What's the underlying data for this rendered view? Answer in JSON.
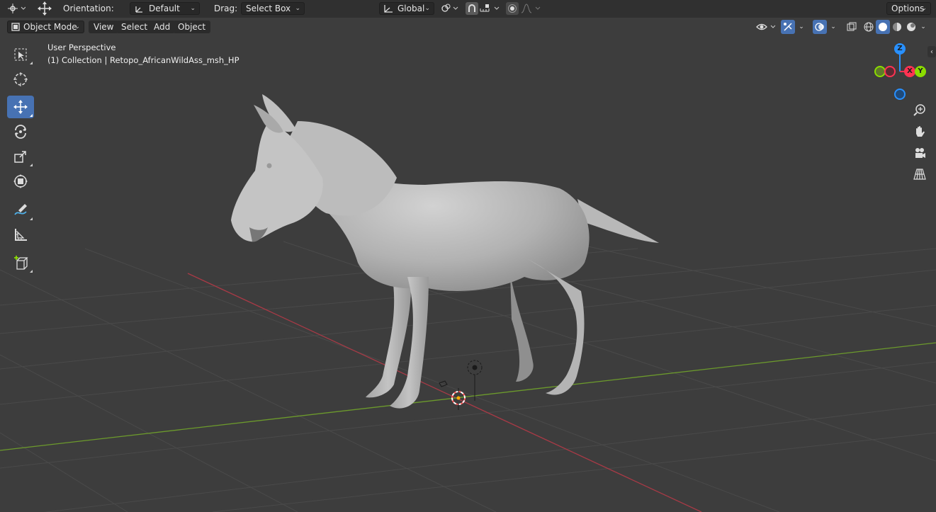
{
  "top_bar": {
    "orientation_label": "Orientation:",
    "orientation_value": "Default",
    "drag_label": "Drag:",
    "drag_value": "Select Box",
    "transform_space": "Global",
    "options_label": "Options"
  },
  "header": {
    "mode": "Object Mode",
    "menus": [
      "View",
      "Select",
      "Add",
      "Object"
    ]
  },
  "viewport": {
    "view_name": "User Perspective",
    "collection_info": "(1) Collection | Retopo_AfricanWildAss_msh_HP"
  },
  "gizmo": {
    "z": "Z",
    "x": "X",
    "y": "Y"
  },
  "tools": [
    "select-box-icon",
    "cursor-icon",
    "move-icon",
    "rotate-icon",
    "scale-icon",
    "transform-icon",
    "annotate-icon",
    "measure-icon",
    "add-cube-icon"
  ],
  "colors": {
    "accent": "#4772b3",
    "background": "#3d3d3d",
    "x_axis": "#ff3352",
    "y_axis": "#8bdc00",
    "z_axis": "#2890ff",
    "model": "#b4b4b4"
  }
}
